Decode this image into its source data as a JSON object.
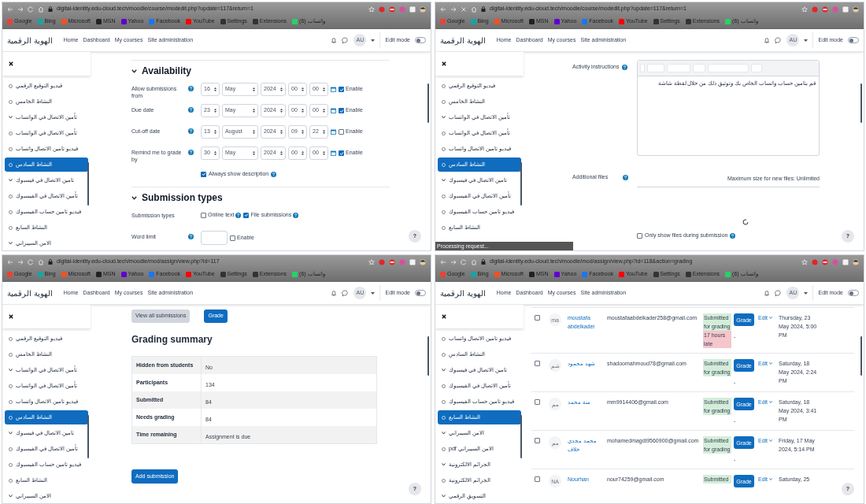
{
  "panels": [
    {
      "browser": {
        "url": "digital-identity.edu-cloud.tech/moodle/course/modedit.php?update=117&return=1",
        "bookmarks": [
          {
            "label": "Google",
            "color": "#ea4335"
          },
          {
            "label": "Bing",
            "color": "#1aa3a3"
          },
          {
            "label": "Microsoft",
            "color": "#f25022"
          },
          {
            "label": "MSN",
            "color": "#222222"
          },
          {
            "label": "Yahoo",
            "color": "#5f01d1"
          },
          {
            "label": "Facebook",
            "color": "#1877f2"
          },
          {
            "label": "YouTube",
            "color": "#ff0000"
          },
          {
            "label": "Settings",
            "color": "#333333"
          },
          {
            "label": "Extensions",
            "color": "#333333"
          },
          {
            "label": "واتساب (6)",
            "color": "#25d366"
          }
        ]
      },
      "navbar": {
        "brand": "الهوية الرقمية",
        "links": [
          "Home",
          "Dashboard",
          "My courses",
          "Site administration"
        ],
        "avatar": "AU",
        "edit_mode": {
          "label": "Edit mode",
          "on": false
        }
      },
      "sidebar": {
        "items": [
          {
            "label": "فيديو التوقيع الرقمي",
            "kind": "activity",
            "selected": false
          },
          {
            "label": "النشاط الخامس",
            "kind": "activity",
            "selected": false
          },
          {
            "label": "تأمين الاتصال في الواتساب",
            "kind": "section",
            "selected": false
          },
          {
            "label": "تأمين الاتصال في الواتساب",
            "kind": "activity",
            "selected": false
          },
          {
            "label": "فيديو تامين الاتصال واتساب",
            "kind": "activity",
            "selected": false
          },
          {
            "label": "النشاط السادس",
            "kind": "activity",
            "selected": true
          },
          {
            "label": "تامين الاتصال في فيسبوك",
            "kind": "section",
            "selected": false
          },
          {
            "label": "تأمين الاتصال في الفيسبوك",
            "kind": "activity",
            "selected": false
          },
          {
            "label": "فيديو تامين حساب الفيسبوك",
            "kind": "activity",
            "selected": false
          },
          {
            "label": "النشاط السابع",
            "kind": "activity",
            "selected": false
          },
          {
            "label": "الامن السيبراني",
            "kind": "section",
            "selected": false
          }
        ]
      },
      "content": {
        "kind": "settings_form",
        "help_button": "?",
        "sections": [
          {
            "title": "Availability",
            "rows": [
              {
                "kind": "date",
                "label": "Allow submissions from",
                "day": "16",
                "month": "May",
                "year": "2024",
                "hour": "00",
                "minute": "00",
                "enable_label": "Enable",
                "enabled": true
              },
              {
                "kind": "date",
                "label": "Due date",
                "day": "23",
                "month": "May",
                "year": "2024",
                "hour": "00",
                "minute": "00",
                "enable_label": "Enable",
                "enabled": true
              },
              {
                "kind": "date",
                "label": "Cut-off date",
                "day": "13",
                "month": "August",
                "year": "2024",
                "hour": "09",
                "minute": "22",
                "enable_label": "Enable",
                "enabled": false
              },
              {
                "kind": "date",
                "label": "Remind me to grade by",
                "day": "30",
                "month": "May",
                "year": "2024",
                "hour": "00",
                "minute": "00",
                "enable_label": "Enable",
                "enabled": true
              },
              {
                "kind": "checkbox",
                "label": "Always show description",
                "checked": true
              }
            ]
          },
          {
            "title": "Submission types",
            "rows": [
              {
                "kind": "options",
                "label": "Submission types",
                "options": [
                  {
                    "label": "Online text",
                    "checked": false
                  },
                  {
                    "label": "File submissions",
                    "checked": true
                  }
                ]
              },
              {
                "kind": "number",
                "label": "Word limit",
                "enable_label": "Enable",
                "enabled": false
              }
            ]
          }
        ]
      }
    },
    {
      "browser": {
        "url": "digital-identity.edu-cloud.tech/moodle/course/modedit.php?update=117&return=1",
        "bookmarks": [
          {
            "label": "Google",
            "color": "#ea4335"
          },
          {
            "label": "Bing",
            "color": "#1aa3a3"
          },
          {
            "label": "Microsoft",
            "color": "#f25022"
          },
          {
            "label": "MSN",
            "color": "#222222"
          },
          {
            "label": "Yahoo",
            "color": "#5f01d1"
          },
          {
            "label": "Facebook",
            "color": "#1877f2"
          },
          {
            "label": "YouTube",
            "color": "#ff0000"
          },
          {
            "label": "Settings",
            "color": "#333333"
          },
          {
            "label": "Extensions",
            "color": "#333333"
          },
          {
            "label": "واتساب (6)",
            "color": "#25d366"
          }
        ]
      },
      "navbar": {
        "brand": "الهوية الرقمية",
        "links": [
          "Home",
          "Dashboard",
          "My courses",
          "Site administration"
        ],
        "avatar": "AU",
        "edit_mode": {
          "label": "Edit mode",
          "on": false
        }
      },
      "sidebar": {
        "items": [
          {
            "label": "فيديو التوقيع الرقمي",
            "kind": "activity",
            "selected": false
          },
          {
            "label": "النشاط الخامس",
            "kind": "activity",
            "selected": false
          },
          {
            "label": "تأمين الاتصال في الواتساب",
            "kind": "section",
            "selected": false
          },
          {
            "label": "تأمين الاتصال في الواتساب",
            "kind": "activity",
            "selected": false
          },
          {
            "label": "فيديو تامين الاتصال واتساب",
            "kind": "activity",
            "selected": false
          },
          {
            "label": "النشاط السادس",
            "kind": "activity",
            "selected": true
          },
          {
            "label": "تامين الاتصال في فيسبوك",
            "kind": "section",
            "selected": false
          },
          {
            "label": "تأمين الاتصال في الفيسبوك",
            "kind": "activity",
            "selected": false
          },
          {
            "label": "فيديو تامين حساب الفيسبوك",
            "kind": "activity",
            "selected": false
          },
          {
            "label": "النشاط السابع",
            "kind": "activity",
            "selected": false
          }
        ]
      },
      "content": {
        "kind": "editor",
        "help_button": "?",
        "instructions_label": "Activity instructions",
        "editor_text": "قم بتامين حساب واتساب الخاص بك وتوثيق ذلك من خلال لقطة شاشة",
        "files_label": "Additional files",
        "max_size": "Maximum size for new files: Unlimited",
        "loading": true,
        "only_show": {
          "label": "Only show files during submission",
          "checked": false
        },
        "status": "Processing request..."
      }
    },
    {
      "browser": {
        "url": "digital-identity.edu-cloud.tech/moodle/mod/assign/view.php?id=117",
        "bookmarks": [
          {
            "label": "Google",
            "color": "#ea4335"
          },
          {
            "label": "Bing",
            "color": "#1aa3a3"
          },
          {
            "label": "Microsoft",
            "color": "#f25022"
          },
          {
            "label": "MSN",
            "color": "#222222"
          },
          {
            "label": "Yahoo",
            "color": "#5f01d1"
          },
          {
            "label": "Facebook",
            "color": "#1877f2"
          },
          {
            "label": "YouTube",
            "color": "#ff0000"
          },
          {
            "label": "Settings",
            "color": "#333333"
          },
          {
            "label": "Extensions",
            "color": "#333333"
          },
          {
            "label": "واتساب (6)",
            "color": "#25d366"
          }
        ]
      },
      "navbar": {
        "brand": "الهوية الرقمية",
        "links": [
          "Home",
          "Dashboard",
          "My courses",
          "Site administration"
        ],
        "avatar": "AU",
        "edit_mode": {
          "label": "Edit mode",
          "on": false
        }
      },
      "sidebar": {
        "items": [
          {
            "label": "فيديو التوقيع الرقمي",
            "kind": "activity",
            "selected": false
          },
          {
            "label": "النشاط الخامس",
            "kind": "activity",
            "selected": false
          },
          {
            "label": "تأمين الاتصال في الواتساب",
            "kind": "section",
            "selected": false
          },
          {
            "label": "تأمين الاتصال في الواتساب",
            "kind": "activity",
            "selected": false
          },
          {
            "label": "فيديو تامين الاتصال واتساب",
            "kind": "activity",
            "selected": false
          },
          {
            "label": "النشاط السادس",
            "kind": "activity",
            "selected": true
          },
          {
            "label": "تامين الاتصال في فيسبوك",
            "kind": "section",
            "selected": false
          },
          {
            "label": "تأمين الاتصال في الفيسبوك",
            "kind": "activity",
            "selected": false
          },
          {
            "label": "فيديو تامين حساب الفيسبوك",
            "kind": "activity",
            "selected": false
          },
          {
            "label": "النشاط السابع",
            "kind": "activity",
            "selected": false
          },
          {
            "label": "الامن السيبراني",
            "kind": "section",
            "selected": false
          }
        ]
      },
      "content": {
        "kind": "summary",
        "help_button": "?",
        "buttons": [
          "View all submissions",
          "Grade"
        ],
        "title": "Grading summary",
        "rows": [
          {
            "label": "Hidden from students",
            "value": "No"
          },
          {
            "label": "Participants",
            "value": "134"
          },
          {
            "label": "Submitted",
            "value": "84"
          },
          {
            "label": "Needs grading",
            "value": "84"
          },
          {
            "label": "Time remaining",
            "value": "Assignment is due"
          }
        ],
        "add_button": "Add submission"
      }
    },
    {
      "browser": {
        "url": "digital-identity.edu-cloud.tech/moodle/mod/assign/view.php?id=118&action=grading",
        "bookmarks": [
          {
            "label": "Google",
            "color": "#ea4335"
          },
          {
            "label": "Bing",
            "color": "#1aa3a3"
          },
          {
            "label": "Microsoft",
            "color": "#f25022"
          },
          {
            "label": "MSN",
            "color": "#222222"
          },
          {
            "label": "Yahoo",
            "color": "#5f01d1"
          },
          {
            "label": "Facebook",
            "color": "#1877f2"
          },
          {
            "label": "YouTube",
            "color": "#ff0000"
          },
          {
            "label": "Settings",
            "color": "#333333"
          },
          {
            "label": "Extensions",
            "color": "#333333"
          },
          {
            "label": "واتساب (6)",
            "color": "#25d366"
          }
        ]
      },
      "navbar": {
        "brand": "الهوية الرقمية",
        "links": [
          "Home",
          "Dashboard",
          "My courses",
          "Site administration"
        ],
        "avatar": "AU",
        "edit_mode": {
          "label": "Edit mode",
          "on": false
        }
      },
      "sidebar": {
        "items": [
          {
            "label": "فيديو تامين الاتصال واتساب",
            "kind": "activity",
            "selected": false
          },
          {
            "label": "النشاط السادس",
            "kind": "activity",
            "selected": false
          },
          {
            "label": "تامين الاتصال في فيسبوك",
            "kind": "section",
            "selected": false
          },
          {
            "label": "تأمين الاتصال في الفيسبوك",
            "kind": "activity",
            "selected": false
          },
          {
            "label": "فيديو تامين حساب الفيسبوك",
            "kind": "activity",
            "selected": false
          },
          {
            "label": "النشاط السابع",
            "kind": "activity",
            "selected": true
          },
          {
            "label": "الامن السيبراني",
            "kind": "section",
            "selected": false
          },
          {
            "label": "الامن السيبراني pdf",
            "kind": "activity",
            "selected": false
          },
          {
            "label": "الجرائم الالكترونية",
            "kind": "section",
            "selected": false
          },
          {
            "label": "الجرائم الالكترونية",
            "kind": "activity",
            "selected": false
          },
          {
            "label": "التسويق الرقمي",
            "kind": "section",
            "selected": false
          }
        ]
      },
      "content": {
        "kind": "grading_table",
        "help_button": "?",
        "rows": [
          {
            "checked": false,
            "initials": "ma",
            "name": "moustafa abdelkader",
            "email": "moustafaabdelkader258@gmail.com",
            "status": "Submitted for grading",
            "late": "17 hours late",
            "grade_button": "Grade",
            "final": "-",
            "edit": "Edit",
            "modified": "Thursday, 23 May 2024, 5:00 PM"
          },
          {
            "checked": false,
            "initials": "شم",
            "name": "شهد محمود",
            "email": "shadoomahmoud78@gmail.com",
            "status": "Submitted for grading",
            "grade_button": "Grade",
            "final": "-",
            "edit": "Edit",
            "modified": "Saturday, 18 May 2024, 2:24 PM"
          },
          {
            "checked": false,
            "initials": "مم",
            "name": "منة محمد",
            "email": "mm9914406@gmail.com",
            "status": "Submitted for grading",
            "grade_button": "Grade",
            "final": "-",
            "edit": "Edit",
            "modified": "Saturday, 18 May 2024, 3:41 PM"
          },
          {
            "checked": false,
            "initials": "مم",
            "name": "محمد مجدي خلاف",
            "email": "mohamedmagdi9560900@gmail.com",
            "status": "Submitted for grading",
            "grade_button": "Grade",
            "final": "-",
            "edit": "Edit",
            "modified": "Friday, 17 May 2024, 5:14 PM"
          },
          {
            "checked": false,
            "initials": "NA",
            "name": "Nourhan",
            "email": "nour74259@gmail.com",
            "status": "Submitted",
            "grade_button": "Grade",
            "edit": "Edit",
            "modified": "Saturday, 25"
          }
        ]
      }
    }
  ]
}
